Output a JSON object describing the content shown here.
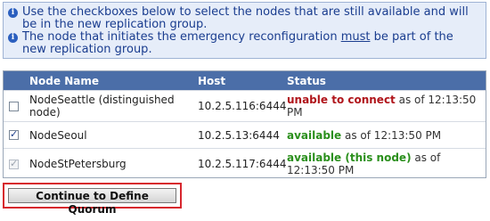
{
  "info": {
    "line1": "Use the checkboxes below to select the nodes that are still available and will be in the new replication group.",
    "line2_pre": "The node that initiates the emergency reconfiguration ",
    "line2_emph": "must",
    "line2_post": " be part of the new replication group."
  },
  "table": {
    "headers": {
      "name": "Node Name",
      "host": "Host",
      "status": "Status"
    },
    "rows": [
      {
        "checked": false,
        "disabled": false,
        "name": "NodeSeattle (distinguished node)",
        "host": "10.2.5.116:6444",
        "status": "unable to connect",
        "status_kind": "bad",
        "time": " as of 12:13:50 PM"
      },
      {
        "checked": true,
        "disabled": false,
        "name": "NodeSeoul",
        "host": "10.2.5.13:6444",
        "status": "available",
        "status_kind": "ok",
        "time": " as of 12:13:50 PM"
      },
      {
        "checked": true,
        "disabled": true,
        "name": "NodeStPetersburg",
        "host": "10.2.5.117:6444",
        "status": "available (this node)",
        "status_kind": "ok",
        "time": " as of 12:13:50 PM"
      }
    ]
  },
  "actions": {
    "continue_label": "Continue to Define Quorum"
  },
  "colors": {
    "info_bg": "#e6edf9",
    "header_bg": "#4b6ea8",
    "bad": "#b0151b",
    "ok": "#2a8f1c",
    "highlight": "#d7262d"
  }
}
